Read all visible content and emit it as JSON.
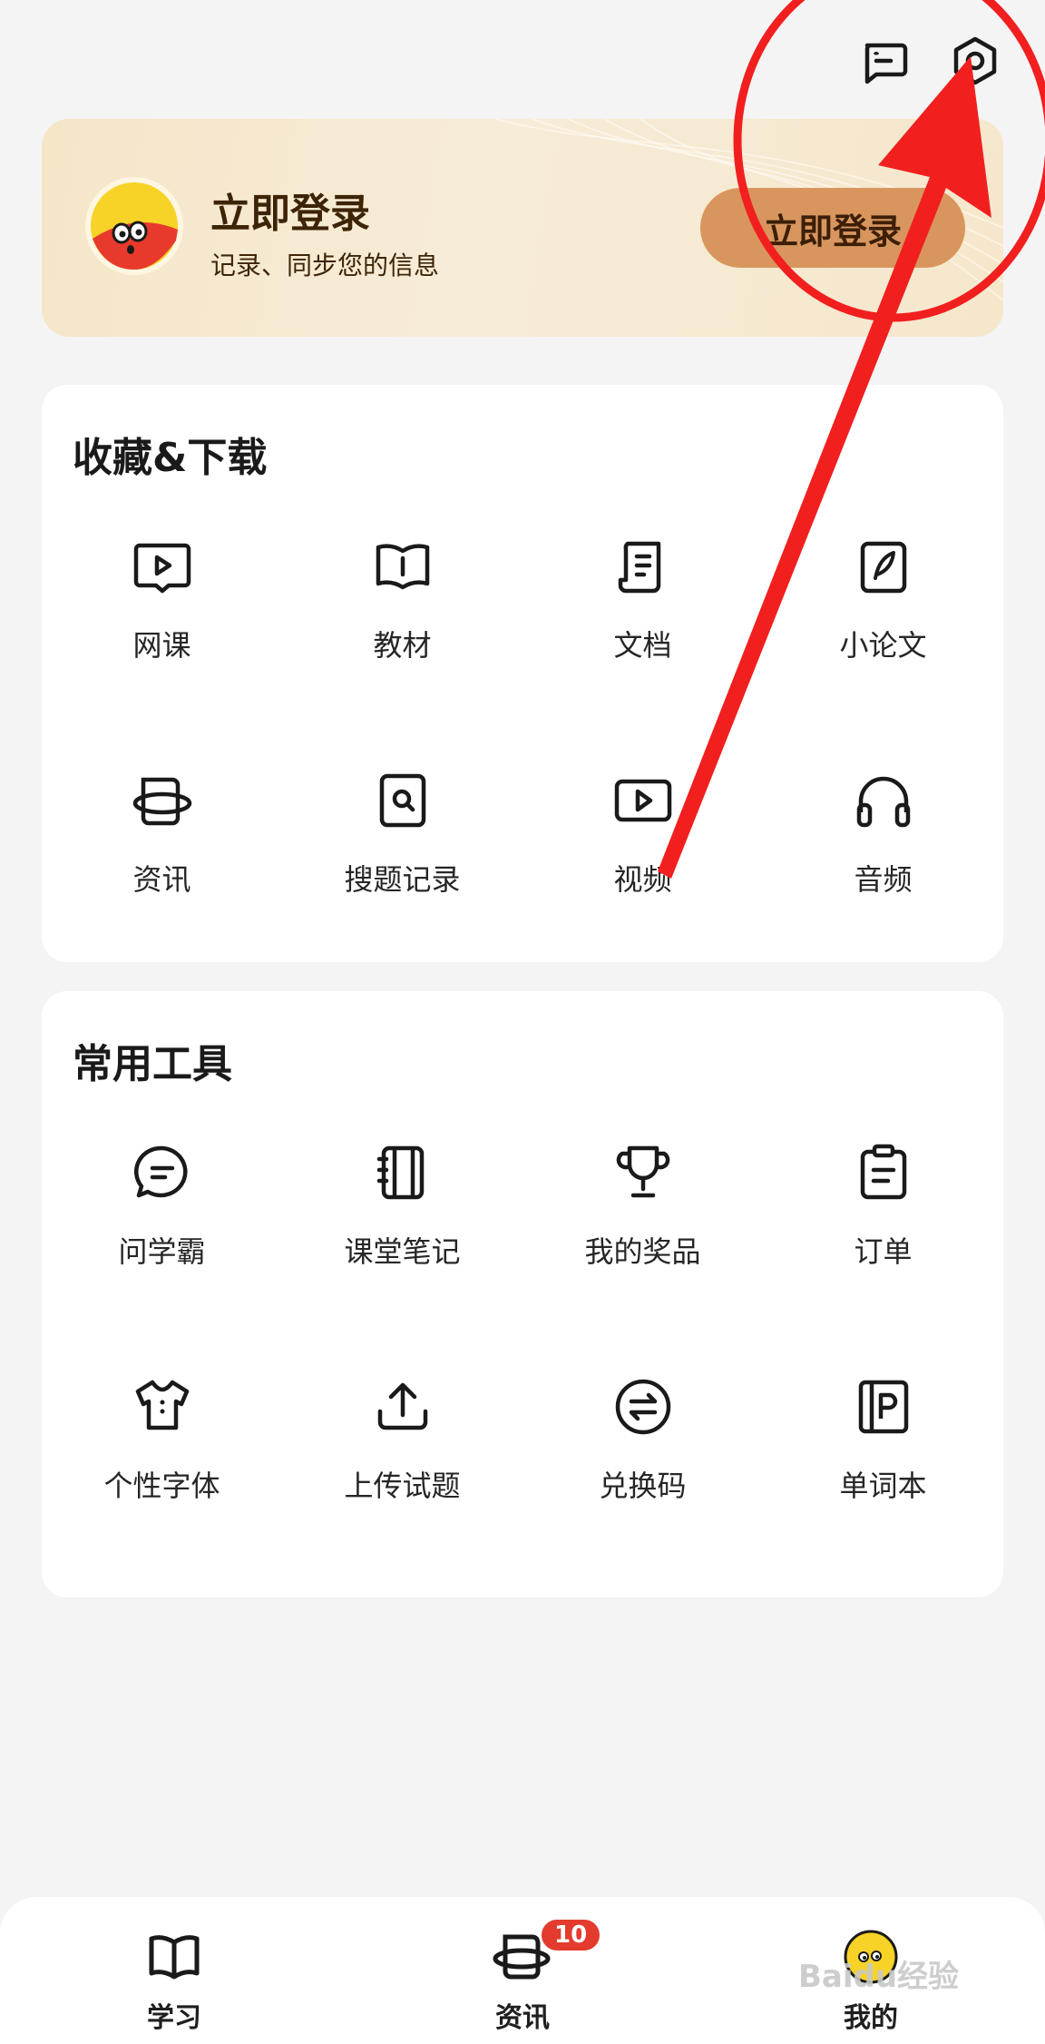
{
  "header": {
    "icons": [
      "message-icon",
      "settings-icon"
    ]
  },
  "banner": {
    "title": "立即登录",
    "subtitle": "记录、同步您的信息",
    "button_label": "立即登录"
  },
  "favorites": {
    "title": "收藏&下载",
    "items": [
      {
        "label": "网课",
        "icon": "video-course-icon"
      },
      {
        "label": "教材",
        "icon": "book-icon"
      },
      {
        "label": "文档",
        "icon": "document-icon"
      },
      {
        "label": "小论文",
        "icon": "pen-icon"
      },
      {
        "label": "资讯",
        "icon": "news-icon"
      },
      {
        "label": "搜题记录",
        "icon": "search-record-icon"
      },
      {
        "label": "视频",
        "icon": "video-icon"
      },
      {
        "label": "音频",
        "icon": "headphones-icon"
      }
    ]
  },
  "tools": {
    "title": "常用工具",
    "items": [
      {
        "label": "问学霸",
        "icon": "chat-icon"
      },
      {
        "label": "课堂笔记",
        "icon": "notebook-icon"
      },
      {
        "label": "我的奖品",
        "icon": "trophy-icon"
      },
      {
        "label": "订单",
        "icon": "clipboard-icon"
      },
      {
        "label": "个性字体",
        "icon": "shirt-icon"
      },
      {
        "label": "上传试题",
        "icon": "upload-icon"
      },
      {
        "label": "兑换码",
        "icon": "exchange-icon"
      },
      {
        "label": "单词本",
        "icon": "wordbook-icon"
      }
    ]
  },
  "bottom_nav": {
    "items": [
      {
        "label": "学习",
        "icon": "book-icon"
      },
      {
        "label": "资讯",
        "icon": "news-icon",
        "badge": "10"
      },
      {
        "label": "我的",
        "icon": "avatar-icon"
      }
    ]
  },
  "watermark": "Baidu经验",
  "colors": {
    "accent": "#d8965e",
    "annotation": "#f21f1f",
    "badge": "#e33b2e"
  }
}
